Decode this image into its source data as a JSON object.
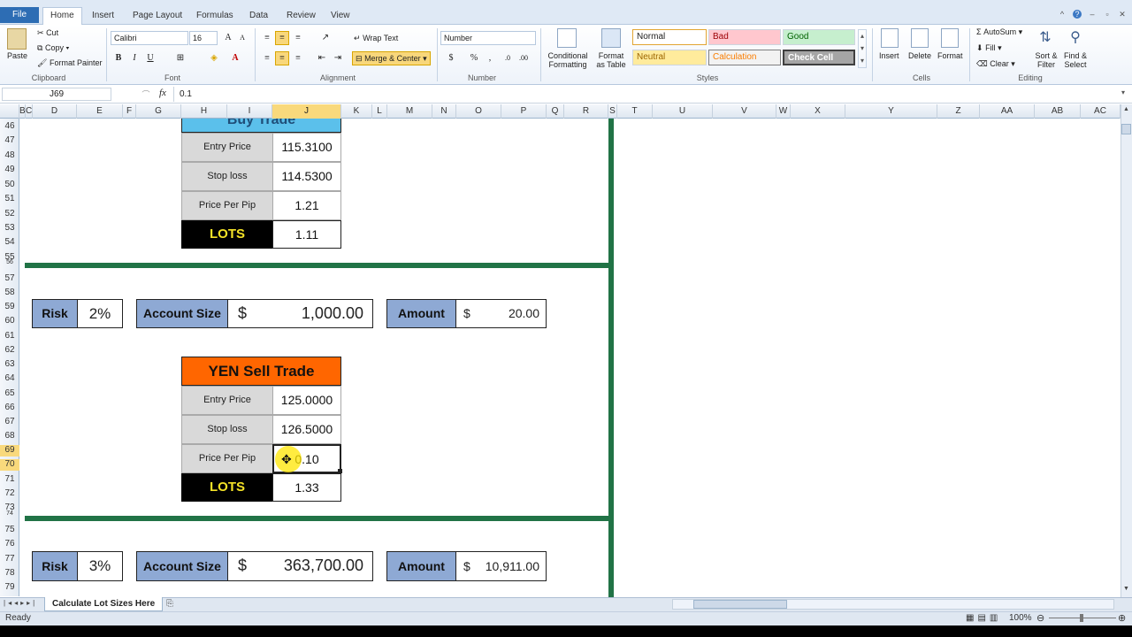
{
  "tabs": {
    "file": "File",
    "items": [
      "Home",
      "Insert",
      "Page Layout",
      "Formulas",
      "Data",
      "Review",
      "View"
    ]
  },
  "ribbon": {
    "clipboard": {
      "paste": "Paste",
      "cut": "Cut",
      "copy": "Copy",
      "format_painter": "Format Painter",
      "label": "Clipboard"
    },
    "font": {
      "name": "Calibri",
      "size": "16",
      "bold": "B",
      "italic": "I",
      "underline": "U",
      "label": "Font"
    },
    "alignment": {
      "wrap_text": "Wrap Text",
      "merge_center": "Merge & Center",
      "label": "Alignment"
    },
    "number": {
      "format": "Number",
      "currency": "$",
      "percent": "%",
      "comma": ",",
      "label": "Number"
    },
    "styles": {
      "conditional": "Conditional",
      "formatting": "Formatting",
      "format_as": "Format",
      "as_table": "as Table",
      "normal": "Normal",
      "bad": "Bad",
      "good": "Good",
      "neutral": "Neutral",
      "calculation": "Calculation",
      "check_cell": "Check Cell",
      "label": "Styles"
    },
    "cells": {
      "insert": "Insert",
      "delete": "Delete",
      "format": "Format",
      "label": "Cells"
    },
    "editing": {
      "autosum": "AutoSum",
      "fill": "Fill",
      "clear": "Clear",
      "sort": "Sort &",
      "filter": "Filter",
      "find": "Find &",
      "select": "Select",
      "label": "Editing"
    }
  },
  "formula_bar": {
    "name_box": "J69",
    "fx": "fx",
    "value": "0.1"
  },
  "columns": [
    "B",
    "C",
    "D",
    "E",
    "F",
    "G",
    "H",
    "I",
    "J",
    "K",
    "L",
    "M",
    "N",
    "O",
    "P",
    "Q",
    "R",
    "S",
    "T",
    "U",
    "V",
    "W",
    "X",
    "Y",
    "Z",
    "AA",
    "AB",
    "AC"
  ],
  "rows": [
    "46",
    "47",
    "48",
    "49",
    "50",
    "51",
    "52",
    "53",
    "54",
    "55",
    "56",
    "57",
    "58",
    "59",
    "60",
    "61",
    "62",
    "63",
    "64",
    "65",
    "66",
    "67",
    "68",
    "69",
    "70",
    "71",
    "72",
    "73",
    "74",
    "75",
    "76",
    "77",
    "78",
    "79"
  ],
  "buy_trade": {
    "title": "Buy Trade",
    "entry_label": "Entry Price",
    "entry_value": "115.3100",
    "stop_label": "Stop loss",
    "stop_value": "114.5300",
    "pip_label": "Price Per Pip",
    "pip_value": "1.21",
    "lots_label": "LOTS",
    "lots_value": "1.11"
  },
  "section2": {
    "risk_label": "Risk",
    "risk_value": "2%",
    "account_label": "Account Size",
    "account_currency": "$",
    "account_value": "1,000.00",
    "amount_label": "Amount",
    "amount_currency": "$",
    "amount_value": "20.00"
  },
  "yen_trade": {
    "title": "YEN Sell Trade",
    "entry_label": "Entry Price",
    "entry_value": "125.0000",
    "stop_label": "Stop loss",
    "stop_value": "126.5000",
    "pip_label": "Price Per Pip",
    "pip_value": "0.10",
    "lots_label": "LOTS",
    "lots_value": "1.33"
  },
  "section3": {
    "risk_label": "Risk",
    "risk_value": "3%",
    "account_label": "Account Size",
    "account_currency": "$",
    "account_value": "363,700.00",
    "amount_label": "Amount",
    "amount_currency": "$",
    "amount_value": "10,911.00"
  },
  "sheet_tab": "Calculate Lot Sizes Here",
  "status": {
    "ready": "Ready",
    "zoom": "100%"
  },
  "colors": {
    "accent_green": "#217346",
    "label_blue": "#8ea9d4",
    "yen_orange": "#ff6600",
    "buy_blue": "#5bc0eb",
    "lots_yellow": "#f4e227"
  }
}
